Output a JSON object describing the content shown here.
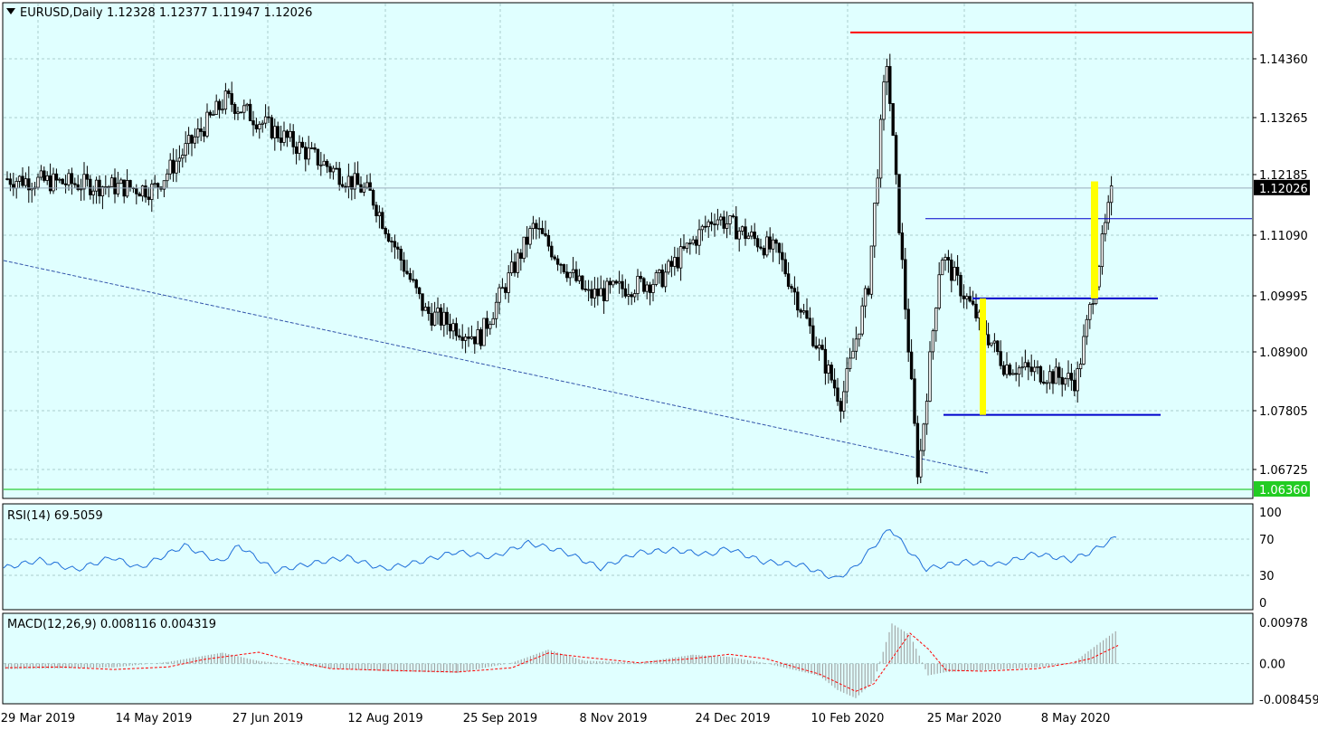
{
  "header": {
    "title": "EURUSD,Daily",
    "ohlc": "1.12328 1.12377 1.11947 1.12026"
  },
  "colors": {
    "background": "#e0ffff",
    "candle_up": "#ffffff",
    "candle_down": "#000000",
    "resistance_line": "#ff0000",
    "support_line": "#00c000",
    "range_lines": "#0000cc",
    "highlight_bar": "#ffff00",
    "trendline": "#3355aa",
    "rsi_line": "#1e6fd9",
    "macd_signal": "#ff0000",
    "macd_hist": "#999999"
  },
  "chart_data": [
    {
      "type": "candlestick",
      "title": "EURUSD,Daily",
      "x_tick_labels": [
        "29 Mar 2019",
        "14 May 2019",
        "27 Jun 2019",
        "12 Aug 2019",
        "25 Sep 2019",
        "8 Nov 2019",
        "24 Dec 2019",
        "10 Feb 2020",
        "25 Mar 2020",
        "8 May 2020"
      ],
      "y_tick_labels": [
        "1.14360",
        "1.13265",
        "1.12185",
        "1.11090",
        "1.09995",
        "1.08900",
        "1.07805",
        "1.06725"
      ],
      "ylim": [
        1.0636,
        1.1505
      ],
      "current_price_label": "1.12026",
      "current_price": 1.12026,
      "support_label": "1.06360",
      "support_price": 1.0636,
      "resistance_price": 1.1495,
      "range_levels": [
        1.1145,
        1.0995,
        1.0776
      ],
      "trend_close": [
        [
          "29 Mar 2019",
          1.122
        ],
        [
          "14 May 2019",
          1.12
        ],
        [
          "27 Jun 2019",
          1.137
        ],
        [
          "12 Aug 2019",
          1.119
        ],
        [
          "2019-09-03",
          1.097
        ],
        [
          "25 Sep 2019",
          1.092
        ],
        [
          "2019-10-18",
          1.113
        ],
        [
          "8 Nov 2019",
          1.1
        ],
        [
          "2019-11-29",
          1.103
        ],
        [
          "24 Dec 2019",
          1.115
        ],
        [
          "2020-01-20",
          1.108
        ],
        [
          "10 Feb 2020",
          1.08
        ],
        [
          "2020-02-28",
          1.102
        ],
        [
          "2020-03-09",
          1.145
        ],
        [
          "2020-03-23",
          1.066
        ],
        [
          "25 Mar 2020",
          1.108
        ],
        [
          "2020-04-15",
          1.087
        ],
        [
          "8 May 2020",
          1.084
        ],
        [
          "2020-05-27",
          1.122
        ]
      ],
      "grid": true
    },
    {
      "type": "line",
      "title": "RSI(14) 69.5059",
      "y_tick_labels": [
        "100",
        "70",
        "30",
        "0"
      ],
      "ylim": [
        0,
        100
      ],
      "levels": [
        70,
        30
      ],
      "points": [
        [
          0,
          38
        ],
        [
          40,
          47
        ],
        [
          80,
          36
        ],
        [
          120,
          50
        ],
        [
          150,
          38
        ],
        [
          200,
          63
        ],
        [
          240,
          44
        ],
        [
          260,
          63
        ],
        [
          300,
          35
        ],
        [
          340,
          43
        ],
        [
          380,
          50
        ],
        [
          420,
          37
        ],
        [
          460,
          45
        ],
        [
          500,
          56
        ],
        [
          540,
          50
        ],
        [
          580,
          66
        ],
        [
          620,
          56
        ],
        [
          660,
          38
        ],
        [
          700,
          55
        ],
        [
          740,
          58
        ],
        [
          780,
          53
        ],
        [
          800,
          60
        ],
        [
          840,
          45
        ],
        [
          880,
          42
        ],
        [
          920,
          26
        ],
        [
          940,
          38
        ],
        [
          980,
          82
        ],
        [
          1000,
          58
        ],
        [
          1020,
          37
        ],
        [
          1060,
          45
        ],
        [
          1100,
          42
        ],
        [
          1140,
          54
        ],
        [
          1180,
          47
        ],
        [
          1200,
          55
        ],
        [
          1230,
          72
        ]
      ],
      "grid": true
    },
    {
      "type": "bar",
      "title": "MACD(12,26,9) 0.008116 0.004319",
      "y_tick_labels": [
        "0.00978",
        "0.00",
        "-0.008459"
      ],
      "ylim": [
        -0.00846,
        0.00978
      ],
      "signal": [
        [
          0,
          -0.001
        ],
        [
          60,
          -0.0008
        ],
        [
          120,
          -0.0014
        ],
        [
          180,
          -0.0008
        ],
        [
          220,
          0.001
        ],
        [
          280,
          0.0027
        ],
        [
          320,
          0.0005
        ],
        [
          360,
          -0.0012
        ],
        [
          420,
          -0.0016
        ],
        [
          500,
          -0.002
        ],
        [
          560,
          -0.001
        ],
        [
          600,
          0.0025
        ],
        [
          640,
          0.0015
        ],
        [
          700,
          0.0002
        ],
        [
          760,
          0.0012
        ],
        [
          800,
          0.0022
        ],
        [
          840,
          0.0012
        ],
        [
          900,
          -0.0025
        ],
        [
          940,
          -0.0066
        ],
        [
          960,
          -0.0048
        ],
        [
          980,
          0.0012
        ],
        [
          1000,
          0.0072
        ],
        [
          1020,
          0.0035
        ],
        [
          1040,
          -0.0016
        ],
        [
          1080,
          -0.0018
        ],
        [
          1140,
          -0.0012
        ],
        [
          1180,
          0.0002
        ],
        [
          1200,
          0.0012
        ],
        [
          1230,
          0.0043
        ]
      ],
      "histogram": [
        [
          0,
          -0.0013
        ],
        [
          60,
          -0.0011
        ],
        [
          120,
          -0.0009
        ],
        [
          180,
          0.0004
        ],
        [
          240,
          0.0026
        ],
        [
          280,
          0.0006
        ],
        [
          320,
          -0.0002
        ],
        [
          360,
          -0.0012
        ],
        [
          420,
          -0.0018
        ],
        [
          500,
          -0.0022
        ],
        [
          560,
          0.0002
        ],
        [
          600,
          0.0033
        ],
        [
          640,
          0.0007
        ],
        [
          700,
          0.0002
        ],
        [
          760,
          0.0021
        ],
        [
          800,
          0.0016
        ],
        [
          840,
          0.0001
        ],
        [
          900,
          -0.0029
        ],
        [
          920,
          -0.0063
        ],
        [
          940,
          -0.0082
        ],
        [
          960,
          -0.0042
        ],
        [
          980,
          0.0095
        ],
        [
          1000,
          0.0068
        ],
        [
          1020,
          -0.0028
        ],
        [
          1040,
          -0.002
        ],
        [
          1080,
          -0.0016
        ],
        [
          1140,
          -0.0009
        ],
        [
          1180,
          0.0001
        ],
        [
          1200,
          0.0034
        ],
        [
          1230,
          0.0081
        ]
      ],
      "grid": true
    }
  ]
}
